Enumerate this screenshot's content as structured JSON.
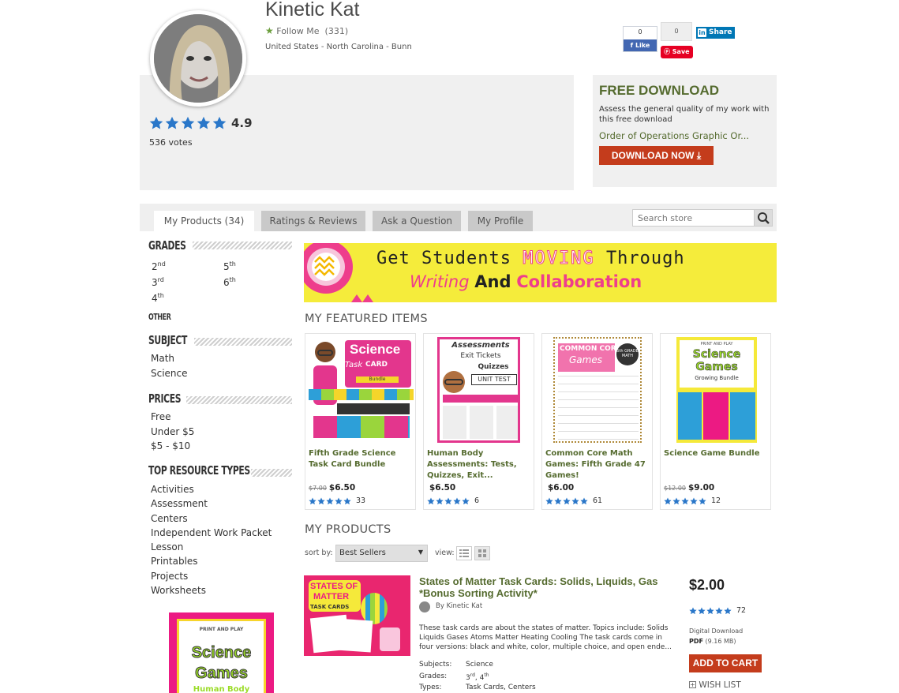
{
  "store": {
    "name": "Kinetic Kat",
    "follow_label": "Follow Me",
    "followers": "(331)",
    "location": "United States - North Carolina - Bunn",
    "rating": "4.9",
    "votes": "536 votes"
  },
  "social": {
    "fb_count": "0",
    "fb_like": "Like",
    "pin_count": "0",
    "pin_save": "Save",
    "li_in": "in",
    "li_share": "Share"
  },
  "free_download": {
    "title": "FREE DOWNLOAD",
    "description": "Assess the general quality of my work with this free download",
    "product": "Order of Operations Graphic Or...",
    "button": "DOWNLOAD NOW"
  },
  "tabs": {
    "products": "My Products (34)",
    "ratings": "Ratings & Reviews",
    "ask": "Ask a Question",
    "profile": "My Profile"
  },
  "search": {
    "placeholder": "Search store"
  },
  "sidebar": {
    "grades_title": "GRADES",
    "grades": [
      {
        "num": "2",
        "suf": "nd"
      },
      {
        "num": "5",
        "suf": "th"
      },
      {
        "num": "3",
        "suf": "rd"
      },
      {
        "num": "6",
        "suf": "th"
      },
      {
        "num": "4",
        "suf": "th"
      }
    ],
    "other": "OTHER",
    "subject_title": "SUBJECT",
    "subjects": [
      "Math",
      "Science"
    ],
    "prices_title": "PRICES",
    "prices": [
      "Free",
      "Under $5",
      "$5 - $10"
    ],
    "types_title": "TOP RESOURCE TYPES",
    "types": [
      "Activities",
      "Assessment",
      "Centers",
      "Independent Work Packet",
      "Lesson",
      "Printables",
      "Projects",
      "Worksheets"
    ],
    "promo": {
      "top": "PRINT AND PLAY",
      "line1": "Science",
      "line2": "Games",
      "line3": "Human Body"
    }
  },
  "banner": {
    "l1a": "Get Students",
    "l1b": "MOVING",
    "l1c": "Through",
    "l2a": "Writing",
    "l2b": "And",
    "l2c": "Collaboration"
  },
  "featured_title": "MY FEATURED ITEMS",
  "featured": [
    {
      "title": "Fifth Grade Science Task Card Bundle",
      "old_price": "$7.00",
      "price": "$6.50",
      "rating_count": "33",
      "cover_a": "Science",
      "cover_b": "Task",
      "cover_c": "CARD",
      "cover_d": "Bundle"
    },
    {
      "title": "Human Body Assessments: Tests, Quizzes, Exit...",
      "old_price": "",
      "price": "$6.50",
      "rating_count": "6",
      "cover_a": "Assessments",
      "cover_b": "Exit Tickets",
      "cover_c": "Quizzes",
      "cover_d": "UNIT TEST"
    },
    {
      "title": "Common Core Math Games: Fifth Grade 47 Games!",
      "old_price": "",
      "price": "$6.00",
      "rating_count": "61",
      "cover_a": "COMMON CORE",
      "cover_b": "Games",
      "cover_c": "5th GRADE",
      "cover_d": "MATH"
    },
    {
      "title": "Science Game Bundle",
      "old_price": "$12.00",
      "price": "$9.00",
      "rating_count": "12",
      "cover_a": "Science",
      "cover_b": "Games",
      "cover_c": "Growing Bundle",
      "cover_d": "PRINT AND PLAY"
    }
  ],
  "products_title": "MY PRODUCTS",
  "sort": {
    "label": "sort by:",
    "value": "Best Sellers",
    "view_label": "view:"
  },
  "product": {
    "title": "States of Matter Task Cards: Solids, Liquids, Gas *Bonus Sorting Activity*",
    "by": "By Kinetic Kat",
    "description": "These task cards are about the states of matter. Topics include: Solids Liquids Gases Atoms Matter Heating Cooling The task cards come in four versions: black and white, color, multiple choice, and open ende...",
    "subjects_label": "Subjects:",
    "subjects": "Science",
    "grades_label": "Grades:",
    "grade_a": "3",
    "grade_a_suf": "rd",
    "grade_b": "4",
    "grade_b_suf": "th",
    "types_label": "Types:",
    "types": "Task Cards, Centers",
    "price": "$2.00",
    "rating_count": "72",
    "digital": "Digital Download",
    "format": "PDF",
    "size": "(9.16 MB)",
    "add_to_cart": "ADD TO CART",
    "wish_list": "WISH LIST",
    "cover_a": "STATES OF",
    "cover_b": "MATTER",
    "cover_c": "TASK CARDS"
  },
  "colors": {
    "accent_green": "#556b2f",
    "cta_red": "#c43c1c",
    "star_blue": "#2a77c9"
  }
}
